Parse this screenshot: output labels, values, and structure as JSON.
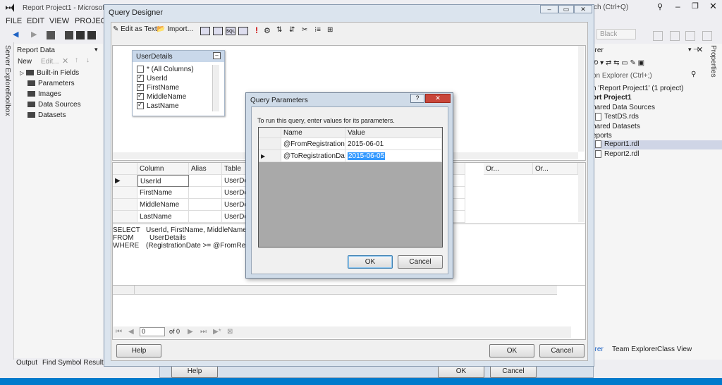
{
  "vs": {
    "title": "Report Project1 - Microsoft V",
    "search_hint": "ch (Ctrl+Q)",
    "menu": [
      "FILE",
      "EDIT",
      "VIEW",
      "PROJECT"
    ],
    "side_tabs": {
      "server_explorer": "Server Explorer",
      "toolbox": "Toolbox",
      "properties": "Properties"
    },
    "toolbar_black": "Black",
    "solution_explorer_label": "orer",
    "solution_search": "on Explorer (Ctrl+;)"
  },
  "report_data": {
    "title": "Report Data",
    "new_label": "New",
    "edit_label": "Edit...",
    "items": [
      "Built-in Fields",
      "Parameters",
      "Images",
      "Data Sources",
      "Datasets"
    ]
  },
  "solution": {
    "items": [
      {
        "label": "n 'Report Project1' (1 project)",
        "bold": false
      },
      {
        "label": "ort Project1",
        "bold": true
      },
      {
        "label": "hared Data Sources",
        "bold": false
      },
      {
        "label": "TestDS.rds",
        "bold": false
      },
      {
        "label": "hared Datasets",
        "bold": false
      },
      {
        "label": "eports",
        "bold": false
      },
      {
        "label": "Report1.rdl",
        "bold": false
      },
      {
        "label": "Report2.rdl",
        "bold": false
      }
    ],
    "bottom_tabs": [
      "orer",
      "Team Explorer",
      "Class View"
    ]
  },
  "bottom_tabs": [
    "Output",
    "Find Symbol Results"
  ],
  "back_dialog": {
    "help": "Help",
    "ok": "OK",
    "cancel": "Cancel"
  },
  "query_designer": {
    "title": "Query Designer",
    "edit_as_text": "Edit as Text",
    "import": "Import...",
    "table": {
      "name": "UserDetails",
      "columns": [
        {
          "label": "* (All Columns)",
          "checked": false
        },
        {
          "label": "UserId",
          "checked": true
        },
        {
          "label": "FirstName",
          "checked": true
        },
        {
          "label": "MiddleName",
          "checked": true
        },
        {
          "label": "LastName",
          "checked": true
        }
      ]
    },
    "grid": {
      "headers": [
        "Column",
        "Alias",
        "Table"
      ],
      "right_headers": [
        "Or...",
        "Or..."
      ],
      "rows": [
        {
          "column": "UserId",
          "table": "UserDetai"
        },
        {
          "column": "FirstName",
          "table": "UserDetai"
        },
        {
          "column": "MiddleName",
          "table": "UserDetai"
        },
        {
          "column": "LastName",
          "table": "UserDeta"
        }
      ]
    },
    "sql": [
      "SELECT",
      "UserId, FirstName, MiddleName, Las",
      "FROM",
      "UserDetails",
      "WHERE",
      "(RegistrationDate >= @FromRegistr"
    ],
    "nav": {
      "page": "0",
      "of": "of 0"
    },
    "help": "Help",
    "ok": "OK",
    "cancel": "Cancel"
  },
  "query_parameters": {
    "title": "Query Parameters",
    "help_glyph": "?",
    "instruction": "To run this query, enter values for its parameters.",
    "headers": [
      "Name",
      "Value"
    ],
    "rows": [
      {
        "name": "@FromRegistrationDat",
        "value": "2015-06-01"
      },
      {
        "name": "@ToRegistrationDate",
        "value": "2015-06-05"
      }
    ],
    "ok": "OK",
    "cancel": "Cancel"
  },
  "colors": {
    "accent": "#007acc",
    "selection": "#3399ff"
  }
}
